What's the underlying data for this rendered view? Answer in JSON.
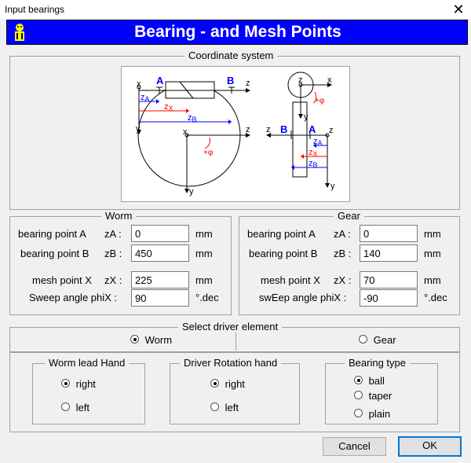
{
  "window": {
    "title": "Input bearings",
    "close_glyph": "✕"
  },
  "banner": {
    "title": "Bearing - and Mesh Points"
  },
  "coordinate_system": {
    "legend": "Coordinate system",
    "worm_labels": {
      "x": "x",
      "y": "y",
      "z": "z",
      "A": "A",
      "B": "B",
      "zA": "z",
      "zA_sub": "A",
      "zB": "z",
      "zB_sub": "B",
      "zX": "z",
      "zX_sub": "X",
      "phi": "+φ"
    },
    "gear_labels": {
      "x": "x",
      "y": "y",
      "z": "z",
      "A": "A",
      "B": "B",
      "zA": "z",
      "zA_sub": "A",
      "zB": "z",
      "zB_sub": "B",
      "zX": "z",
      "zX_sub": "X",
      "phi": "+φ"
    },
    "colors": {
      "blue": "#0000ff",
      "red": "#ff0000",
      "darkblue": "#000080"
    }
  },
  "worm": {
    "legend": "Worm",
    "rows": [
      {
        "label": "bearing point A",
        "symbol": "zA :",
        "value": "0",
        "unit": "mm"
      },
      {
        "label": "bearing point B",
        "symbol": "zB :",
        "value": "450",
        "unit": "mm"
      },
      {
        "label": "mesh point X",
        "symbol": "zX :",
        "value": "225",
        "unit": "mm"
      },
      {
        "label": "Sweep angle phiX :",
        "symbol": "",
        "value": "90",
        "unit": "°.dec"
      }
    ]
  },
  "gear": {
    "legend": "Gear",
    "rows": [
      {
        "label": "bearing point A",
        "symbol": "zA :",
        "value": "0",
        "unit": "mm"
      },
      {
        "label": "bearing point B",
        "symbol": "zB :",
        "value": "140",
        "unit": "mm"
      },
      {
        "label": "mesh point X",
        "symbol": "zX :",
        "value": "70",
        "unit": "mm"
      },
      {
        "label": "swEep angle phiX :",
        "symbol": "",
        "value": "-90",
        "unit": "°.dec"
      }
    ]
  },
  "driver": {
    "legend": "Select driver element",
    "options": [
      {
        "label": "Worm",
        "selected": true
      },
      {
        "label": "Gear",
        "selected": false
      }
    ]
  },
  "worm_lead_hand": {
    "legend": "Worm lead Hand",
    "options": [
      {
        "label": "right",
        "selected": true
      },
      {
        "label": "left",
        "selected": false
      }
    ]
  },
  "driver_rotation_hand": {
    "legend": "Driver Rotation hand",
    "options": [
      {
        "label": "right",
        "selected": true
      },
      {
        "label": "left",
        "selected": false
      }
    ]
  },
  "bearing_type": {
    "legend": "Bearing type",
    "options": [
      {
        "label": "ball",
        "selected": true
      },
      {
        "label": "taper",
        "selected": false
      },
      {
        "label": "plain",
        "selected": false
      }
    ]
  },
  "buttons": {
    "cancel": "Cancel",
    "ok": "OK"
  }
}
